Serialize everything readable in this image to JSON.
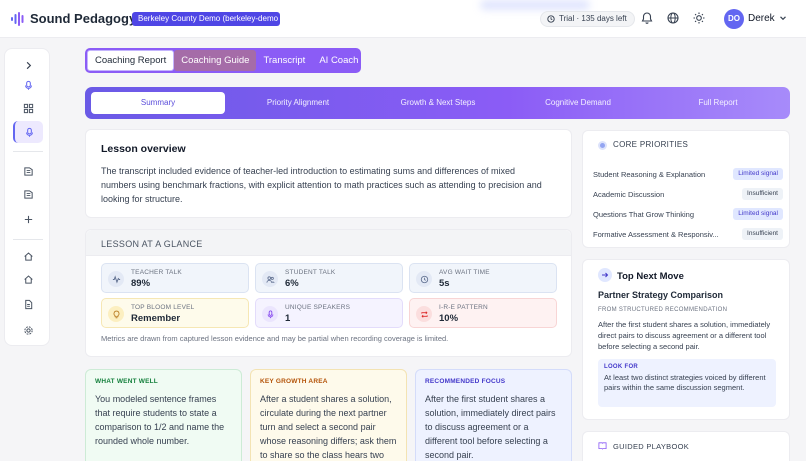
{
  "app": {
    "brand": "Sound Pedagogy",
    "tenant": "Berkeley County Demo (berkeley-demo",
    "trial": "Trial · 135 days left",
    "user": {
      "initials": "DO",
      "name": "Derek"
    }
  },
  "colors": {
    "accent": "#6366f1",
    "violet": "#8b5cf6"
  },
  "top_tabs": [
    {
      "label": "Coaching Report",
      "active": true
    },
    {
      "label": "Coaching Guide"
    },
    {
      "label": "Transcript"
    },
    {
      "label": "AI Coach"
    }
  ],
  "sub_tabs": [
    {
      "label": "Summary",
      "active": true
    },
    {
      "label": "Priority Alignment"
    },
    {
      "label": "Growth & Next Steps"
    },
    {
      "label": "Cognitive Demand"
    },
    {
      "label": "Full Report"
    }
  ],
  "overview": {
    "title": "Lesson overview",
    "body": "The transcript included evidence of teacher-led introduction to estimating sums and differences of mixed numbers using benchmark fractions, with explicit attention to math practices such as attending to precision and looking for structure."
  },
  "glance": {
    "title": "LESSON AT A GLANCE",
    "metrics": [
      {
        "label": "TEACHER TALK",
        "value": "89%",
        "icon": "waveform-icon"
      },
      {
        "label": "STUDENT TALK",
        "value": "6%",
        "icon": "users-icon"
      },
      {
        "label": "AVG WAIT TIME",
        "value": "5s",
        "icon": "clock-icon"
      },
      {
        "label": "TOP BLOOM LEVEL",
        "value": "Remember",
        "icon": "lightbulb-icon"
      },
      {
        "label": "UNIQUE SPEAKERS",
        "value": "1",
        "icon": "microphone-icon"
      },
      {
        "label": "I-R-E PATTERN",
        "value": "10%",
        "icon": "repeat-icon"
      }
    ],
    "note": "Metrics are drawn from captured lesson evidence and may be partial when recording coverage is limited."
  },
  "feedback_cards": [
    {
      "heading": "WHAT WENT WELL",
      "body": "You modeled sentence frames that require students to state a comparison to 1/2 and name the rounded whole number."
    },
    {
      "heading": "KEY GROWTH AREA",
      "body": "After a student shares a solution, circulate during the next partner turn and select a second pair whose reasoning differs; ask them to share so the class hears two"
    },
    {
      "heading": "RECOMMENDED FOCUS",
      "body": "After the first student shares a solution, immediately direct pairs to discuss agreement or a different tool before selecting a second pair."
    }
  ],
  "core_priorities": {
    "title": "CORE PRIORITIES",
    "items": [
      {
        "name": "Student Reasoning & Explanation",
        "badge": "Limited signal",
        "kind": "limited"
      },
      {
        "name": "Academic Discussion",
        "badge": "Insufficient",
        "kind": "insuff"
      },
      {
        "name": "Questions That Grow Thinking",
        "badge": "Limited signal",
        "kind": "limited"
      },
      {
        "name": "Formative Assessment & Responsiv...",
        "badge": "Insufficient",
        "kind": "insuff"
      }
    ]
  },
  "top_next_move": {
    "title": "Top Next Move",
    "subtitle": "Partner Strategy Comparison",
    "from": "FROM STRUCTURED RECOMMENDATION",
    "body": "After the first student shares a solution, immediately direct pairs to discuss agreement or a different tool before selecting a second pair.",
    "look_for_heading": "LOOK FOR",
    "look_for_body": "At least two distinct strategies voiced by different pairs within the same discussion segment."
  },
  "guided_playbook": {
    "title": "GUIDED PLAYBOOK"
  }
}
